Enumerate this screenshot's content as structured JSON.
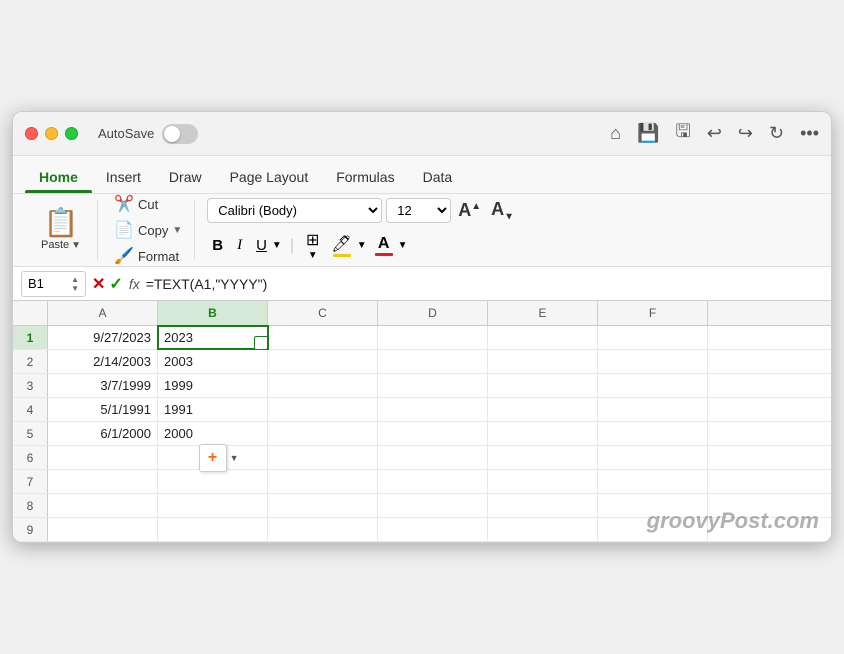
{
  "titlebar": {
    "autosave_label": "AutoSave",
    "more_icon": "•••"
  },
  "tabs": {
    "items": [
      {
        "label": "Home",
        "active": true
      },
      {
        "label": "Insert",
        "active": false
      },
      {
        "label": "Draw",
        "active": false
      },
      {
        "label": "Page Layout",
        "active": false
      },
      {
        "label": "Formulas",
        "active": false
      },
      {
        "label": "Data",
        "active": false
      }
    ]
  },
  "ribbon": {
    "paste_label": "Paste",
    "cut_label": "Cut",
    "copy_label": "Copy",
    "format_label": "Format",
    "font_name": "Calibri (Body)",
    "font_size": "12",
    "bold_label": "B",
    "italic_label": "I",
    "underline_label": "U"
  },
  "formula_bar": {
    "cell_ref": "B1",
    "formula": "=TEXT(A1,\"YYYY\")"
  },
  "columns": [
    "A",
    "B",
    "C",
    "D",
    "E",
    "F"
  ],
  "rows": [
    {
      "num": 1,
      "a": "9/27/2023",
      "b": "2023",
      "selected_b": true
    },
    {
      "num": 2,
      "a": "2/14/2003",
      "b": "2003"
    },
    {
      "num": 3,
      "a": "3/7/1999",
      "b": "1999"
    },
    {
      "num": 4,
      "a": "5/1/1991",
      "b": "1991"
    },
    {
      "num": 5,
      "a": "6/1/2000",
      "b": "2000"
    },
    {
      "num": 6,
      "a": "",
      "b": ""
    },
    {
      "num": 7,
      "a": "",
      "b": ""
    },
    {
      "num": 8,
      "a": "",
      "b": ""
    },
    {
      "num": 9,
      "a": "",
      "b": ""
    }
  ],
  "watermark": "groovyPost.com"
}
